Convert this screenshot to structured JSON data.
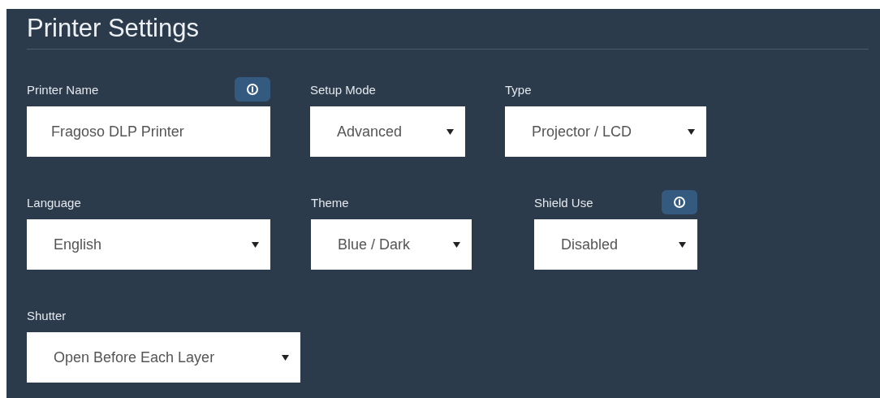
{
  "title": "Printer Settings",
  "rows": [
    {
      "fields": [
        {
          "label": "Printer Name",
          "kind": "text",
          "value": "Fragoso DLP Printer",
          "info": true
        },
        {
          "label": "Setup Mode",
          "kind": "select",
          "value": "Advanced",
          "info": false
        },
        {
          "label": "Type",
          "kind": "select",
          "value": "Projector / LCD",
          "info": false
        }
      ]
    },
    {
      "fields": [
        {
          "label": "Language",
          "kind": "select",
          "value": "English",
          "info": false
        },
        {
          "label": "Theme",
          "kind": "select",
          "value": "Blue / Dark",
          "info": false
        },
        {
          "label": "Shield Use",
          "kind": "select",
          "value": "Disabled",
          "info": true
        }
      ]
    },
    {
      "fields": [
        {
          "label": "Shutter",
          "kind": "select",
          "value": "Open Before Each Layer",
          "info": false
        }
      ]
    }
  ]
}
